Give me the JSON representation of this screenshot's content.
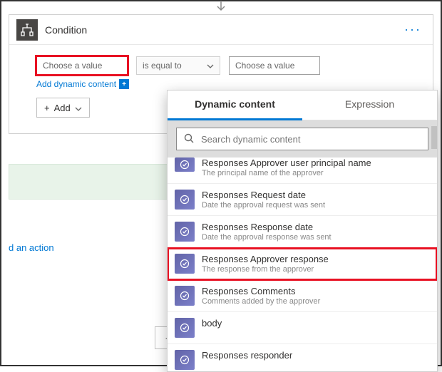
{
  "arrow": {
    "label": "flow-arrow"
  },
  "condition": {
    "title": "Condition",
    "value1_placeholder": "Choose a value",
    "operator": "is equal to",
    "value2_placeholder": "Choose a value",
    "add_dynamic": "Add dynamic content",
    "add_btn": "Add"
  },
  "an_action": "d an action",
  "new_step": "+  Ne",
  "popup": {
    "tabs": {
      "dynamic": "Dynamic content",
      "expression": "Expression"
    },
    "search_placeholder": "Search dynamic content",
    "items": [
      {
        "title": "Responses Approver user principal name",
        "sub": "The principal name of the approver",
        "partial": true
      },
      {
        "title": "Responses Request date",
        "sub": "Date the approval request was sent"
      },
      {
        "title": "Responses Response date",
        "sub": "Date the approval response was sent"
      },
      {
        "title": "Responses Approver response",
        "sub": "The response from the approver",
        "highlight": true
      },
      {
        "title": "Responses Comments",
        "sub": "Comments added by the approver"
      },
      {
        "title": "body",
        "sub": ""
      },
      {
        "title": "Responses responder",
        "sub": ""
      }
    ]
  }
}
